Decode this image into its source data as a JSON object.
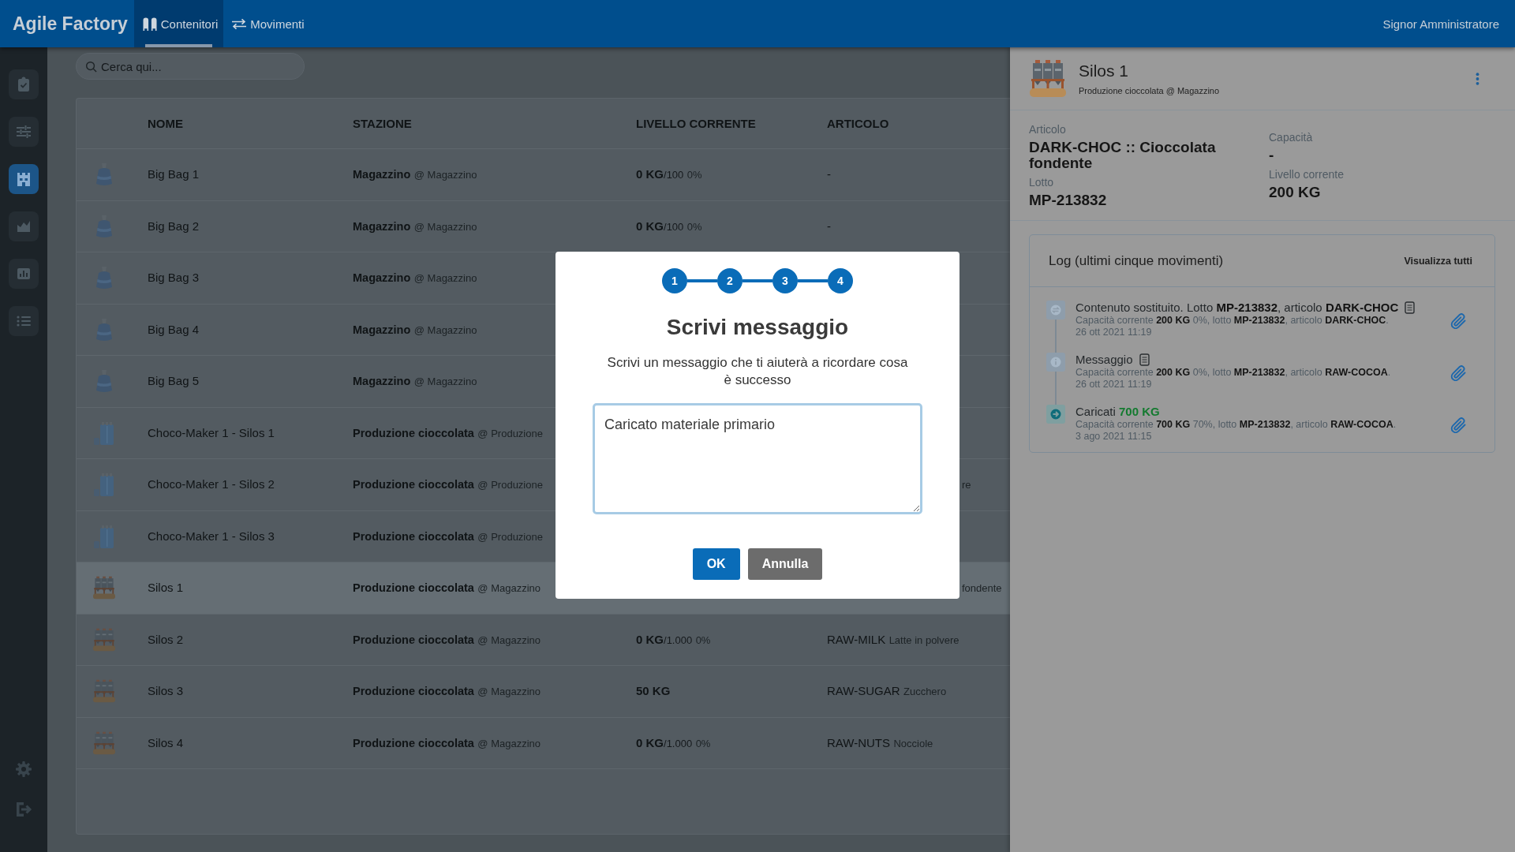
{
  "header": {
    "logo": "Agile Factory",
    "tabs": [
      {
        "label": "Contenitori",
        "kind": "containers",
        "selected": true
      },
      {
        "label": "Movimenti",
        "kind": "movements",
        "selected": false
      }
    ],
    "user": "Signor Amministratore"
  },
  "sidebar": {
    "items": [
      {
        "kind": "tasks",
        "selected": false
      },
      {
        "kind": "sliders",
        "selected": false
      },
      {
        "kind": "warehouse",
        "selected": true
      },
      {
        "kind": "area",
        "selected": false
      },
      {
        "kind": "bars",
        "selected": false
      },
      {
        "kind": "list",
        "selected": false
      }
    ],
    "bottom_items": [
      {
        "kind": "settings"
      },
      {
        "kind": "logout"
      }
    ]
  },
  "search": {
    "placeholder": "Cerca qui..."
  },
  "table": {
    "columns": [
      "NOME",
      "STAZIONE",
      "LIVELLO CORRENTE",
      "ARTICOLO"
    ],
    "rows": [
      {
        "kind": "bag",
        "name": "Big Bag 1",
        "station": "Magazzino",
        "location": "@ Magazzino",
        "current": {
          "amount": "0 KG",
          "capacity": "/100",
          "percent": "0%"
        },
        "article": {
          "code": "-"
        },
        "selected": false
      },
      {
        "kind": "bag",
        "name": "Big Bag 2",
        "station": "Magazzino",
        "location": "@ Magazzino",
        "current": {
          "amount": "0 KG",
          "capacity": "/100",
          "percent": "0%"
        },
        "article": {
          "code": "-"
        },
        "selected": false
      },
      {
        "kind": "bag",
        "name": "Big Bag 3",
        "station": "Magazzino",
        "location": "@ Magazzino",
        "selected": false
      },
      {
        "kind": "bag",
        "name": "Big Bag 4",
        "station": "Magazzino",
        "location": "@ Magazzino",
        "selected": false
      },
      {
        "kind": "bag",
        "name": "Big Bag 5",
        "station": "Magazzino",
        "location": "@ Magazzino",
        "selected": false
      },
      {
        "kind": "tank",
        "name": "Choco-Maker 1 - Silos 1",
        "station": "Produzione cioccolata",
        "location": "@ Produzione",
        "selected": false
      },
      {
        "kind": "tank",
        "name": "Choco-Maker 1 - Silos 2",
        "station": "Produzione cioccolata",
        "location": "@ Produzione",
        "article_tail": "re",
        "selected": false
      },
      {
        "kind": "tank",
        "name": "Choco-Maker 1 - Silos 3",
        "station": "Produzione cioccolata",
        "location": "@ Produzione",
        "selected": false
      },
      {
        "kind": "silos",
        "name": "Silos 1",
        "station": "Produzione cioccolata",
        "location": "@ Magazzino",
        "article_tail": "fondente",
        "selected": true
      },
      {
        "kind": "silos",
        "name": "Silos 2",
        "station": "Produzione cioccolata",
        "location": "@ Magazzino",
        "current": {
          "amount": "0 KG",
          "capacity": "/1.000",
          "percent": "0%"
        },
        "article": {
          "code": "RAW-MILK",
          "name": "Latte in polvere"
        },
        "selected": false
      },
      {
        "kind": "silos",
        "name": "Silos 3",
        "station": "Produzione cioccolata",
        "location": "@ Magazzino",
        "current": {
          "amount": "50 KG"
        },
        "article": {
          "code": "RAW-SUGAR",
          "name": "Zucchero"
        },
        "selected": false
      },
      {
        "kind": "silos",
        "name": "Silos 4",
        "station": "Produzione cioccolata",
        "location": "@ Magazzino",
        "current": {
          "amount": "0 KG",
          "capacity": "/1.000",
          "percent": "0%"
        },
        "article": {
          "code": "RAW-NUTS",
          "name": "Nocciole"
        },
        "selected": false
      }
    ]
  },
  "panel": {
    "kind": "silos",
    "title": "Silos 1",
    "subtitle": "Produzione cioccolata @ Magazzino",
    "details": [
      {
        "fields": [
          {
            "label": "Articolo",
            "value": "DARK-CHOC :: Cioccolata fondente"
          },
          {
            "label": "Lotto",
            "value": "MP-213832"
          }
        ]
      },
      {
        "fields": [
          {
            "label": "Capacità",
            "value": "-"
          },
          {
            "label": "Livello corrente",
            "value": "200 KG"
          }
        ]
      }
    ],
    "log": {
      "title": "Log (ultimi cinque movimenti)",
      "link": "Visualizza tutti",
      "entries": [
        {
          "kind": "replaced",
          "title": "Contenuto sostituito. Lotto **MP-213832**, articolo **DARK-CHOC**",
          "note": true,
          "detail": "Capacità corrente **200 KG** 0%, lotto **MP-213832**, articolo **DARK-CHOC**.",
          "date": "26 ott 2021 11:19"
        },
        {
          "kind": "message",
          "title": "Messaggio",
          "note": true,
          "detail": "Capacità corrente **200 KG** 0%, lotto **MP-213832**, articolo **RAW-COCOA**.",
          "date": "26 ott 2021 11:19"
        },
        {
          "kind": "loaded",
          "title": "Caricati",
          "amount": "700 KG",
          "note": false,
          "detail": "Capacità corrente **700 KG** 70%, lotto **MP-213832**, articolo **RAW-COCOA**.",
          "date": "3 ago 2021 11:15"
        }
      ]
    }
  },
  "modal": {
    "steps": [
      {
        "label": "1",
        "done": true
      },
      {
        "label": "2",
        "done": true
      },
      {
        "label": "3",
        "done": true
      },
      {
        "label": "4",
        "done": true
      }
    ],
    "title": "Scrivi messaggio",
    "text": "Scrivi un messaggio che ti aiuterà a ricordare cosa è successo",
    "message": {
      "value": "Caricato materiale primario"
    },
    "buttons": [
      {
        "label": "OK",
        "kind": "primary"
      },
      {
        "label": "Annulla",
        "kind": "secondary"
      }
    ]
  }
}
